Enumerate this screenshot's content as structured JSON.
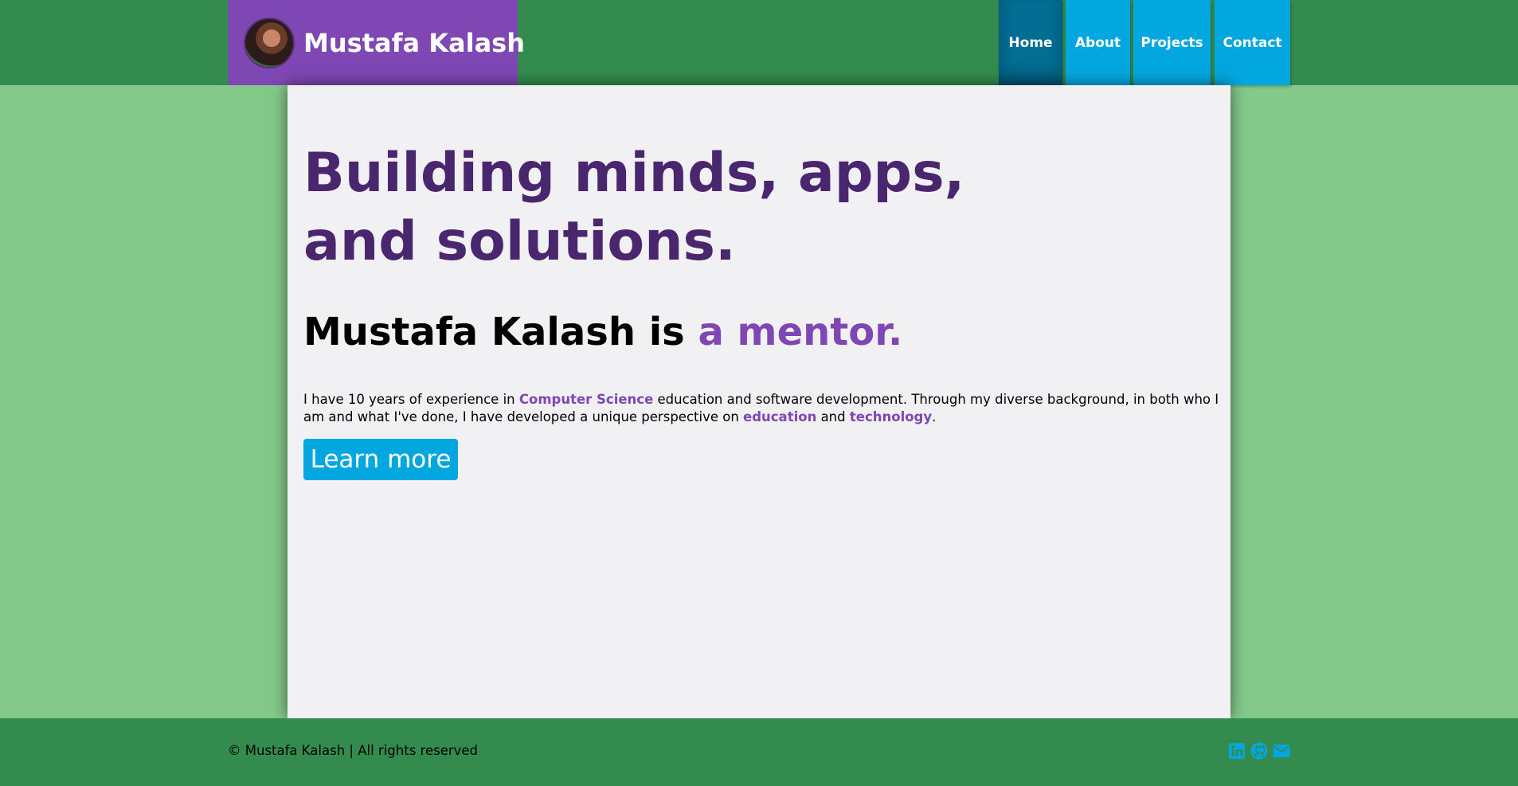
{
  "header": {
    "brand_name": "Mustafa Kalash",
    "nav": [
      {
        "label": "Home",
        "active": true
      },
      {
        "label": "About",
        "active": false
      },
      {
        "label": "Projects",
        "active": false
      },
      {
        "label": "Contact",
        "active": false
      }
    ]
  },
  "main": {
    "hero_title": "Building minds, apps, and solutions.",
    "tagline_prefix": "Mustafa Kalash is ",
    "tagline_accent": "a mentor.",
    "intro": {
      "p1": "I have 10 years of experience in ",
      "hl1": "Computer Science",
      "p2": " education and software development. Through my diverse background, in both who I am and what I've done, I have developed a unique perspective on ",
      "hl2": "education",
      "p3": " and ",
      "hl3": "technology",
      "p4": "."
    },
    "cta_label": "Learn more"
  },
  "footer": {
    "copyright": "© Mustafa Kalash | All rights reserved",
    "social_icons": [
      "linkedin-icon",
      "github-icon",
      "envelope-icon"
    ]
  },
  "colors": {
    "header_bg": "#338b4d",
    "page_bg": "#82c98a",
    "brand_bg": "#7e47b3",
    "nav_bg": "#03a7e0",
    "nav_active_bg": "#036d93",
    "title_color": "#4a266e",
    "accent": "#7e47b3"
  }
}
